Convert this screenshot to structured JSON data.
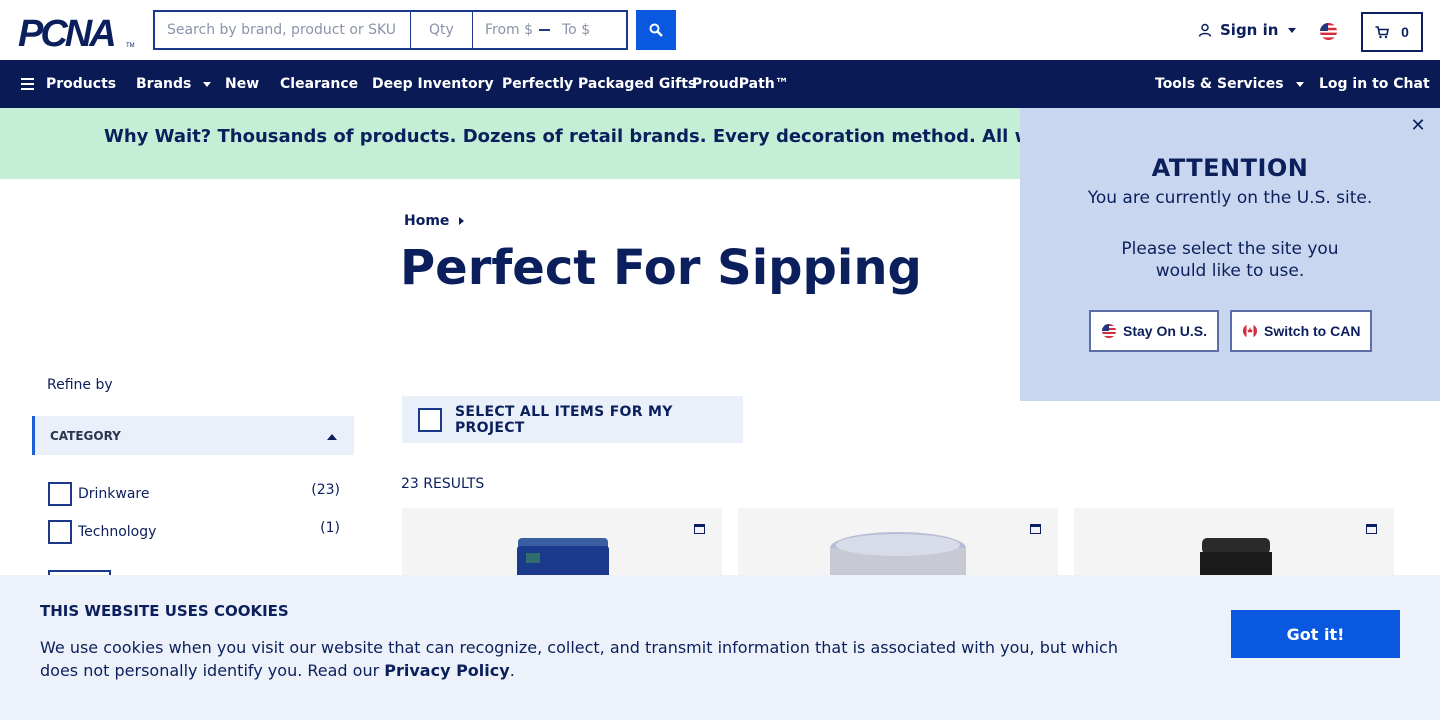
{
  "header": {
    "logo": "PCNA",
    "search_placeholder": "Search by brand, product or SKU",
    "qty_placeholder": "Qty",
    "from_placeholder": "From $",
    "to_placeholder": "To $",
    "sign_in": "Sign in",
    "cart_count": "0"
  },
  "nav": {
    "products": "Products",
    "brands": "Brands",
    "new": "New",
    "clearance": "Clearance",
    "deep_inventory": "Deep Inventory",
    "gifts": "Perfectly Packaged Gifts",
    "proudpath": "ProudPath™",
    "tools": "Tools & Services",
    "chat": "Log in to Chat"
  },
  "promo": {
    "text": "Why Wait? Thousands of products. Dozens of retail brands. Every decoration method. All with a standard"
  },
  "breadcrumb": {
    "home": "Home"
  },
  "page_title": "Perfect For Sipping",
  "sidebar": {
    "refine_by": "Refine by",
    "category_header": "CATEGORY",
    "facets": [
      {
        "name": "Drinkware",
        "count": "(23)"
      },
      {
        "name": "Technology",
        "count": "(1)"
      }
    ]
  },
  "main": {
    "select_all": "SELECT ALL ITEMS FOR MY PROJECT",
    "results": "23 RESULTS"
  },
  "attention": {
    "title": "ATTENTION",
    "line1": "You are currently on the U.S. site.",
    "line2": "Please select the site you would like to use.",
    "stay_us": "Stay On U.S.",
    "switch_can": "Switch to CAN"
  },
  "cookie": {
    "title": "THIS WEBSITE USES COOKIES",
    "text": "We use cookies when you visit our website that can recognize, collect, and transmit information that is associated with you, but which does not personally identify you. Read our",
    "privacy_link": "Privacy Policy",
    "period": ".",
    "button": "Got it!"
  },
  "colors": {
    "navy": "#0a1a55",
    "accent_blue": "#0a57e0",
    "promo_green": "#c4efd6",
    "panel_blue": "#c8d7ef",
    "cookie_bg": "#edf2fa"
  }
}
